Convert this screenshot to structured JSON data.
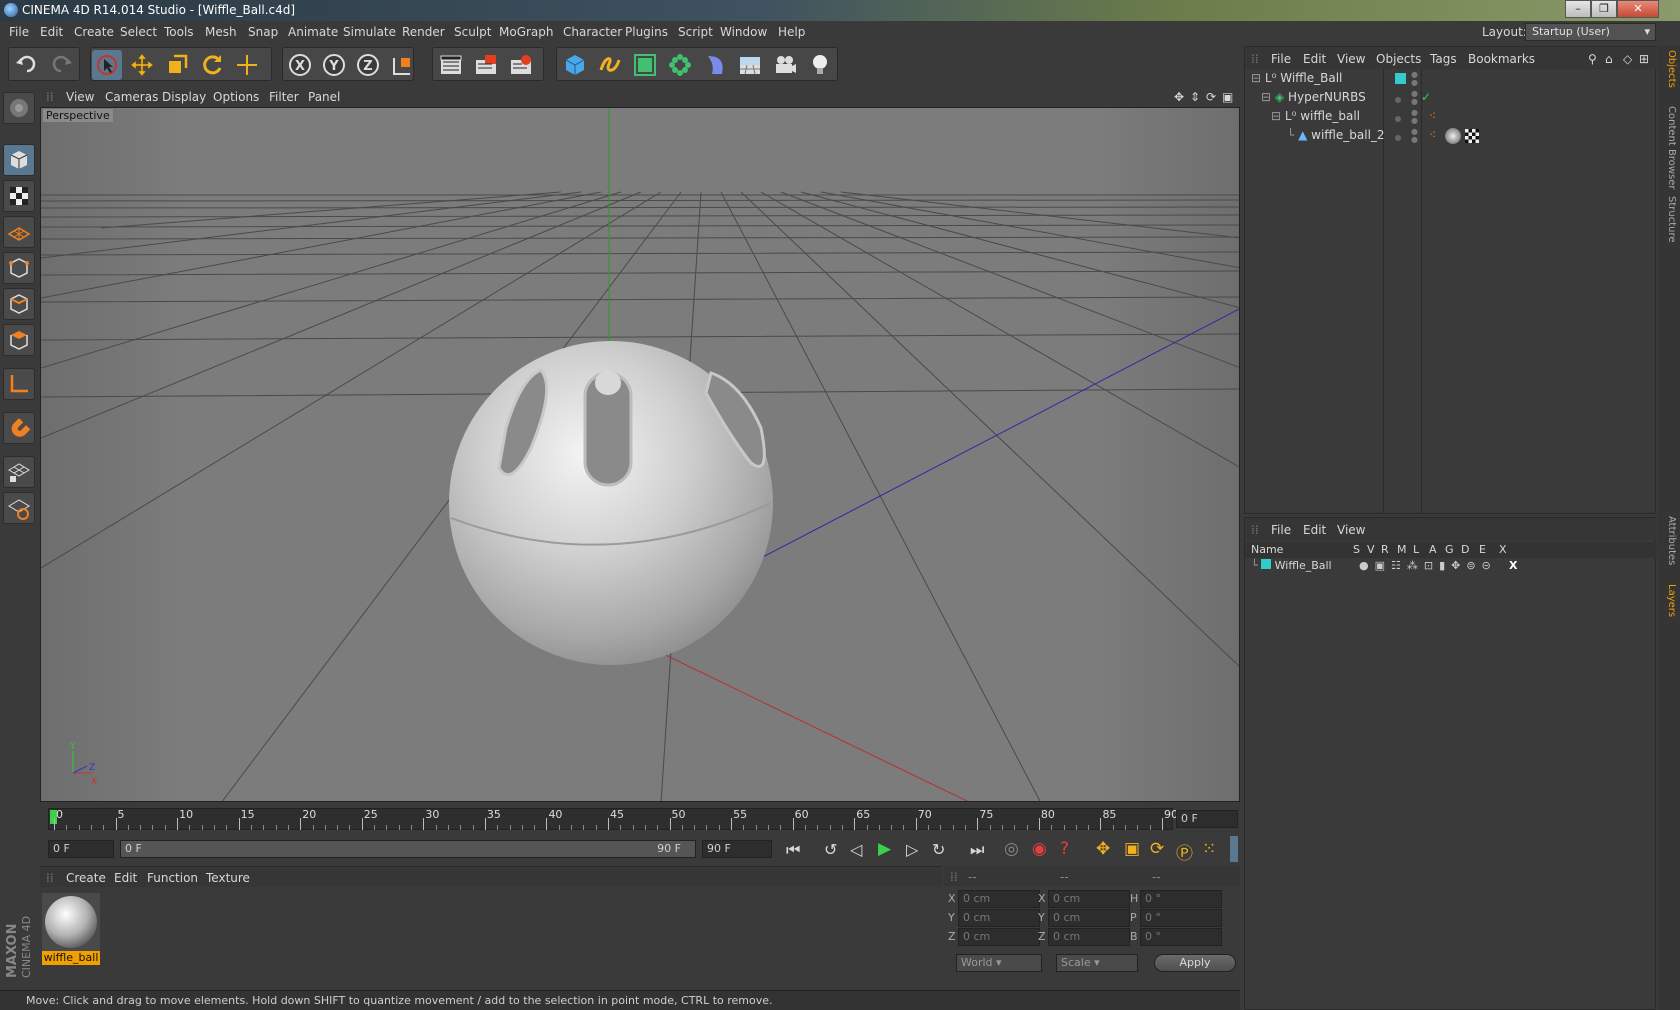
{
  "window": {
    "title": "CINEMA 4D R14.014 Studio - [Wiffle_Ball.c4d]"
  },
  "menu": [
    "File",
    "Edit",
    "Create",
    "Select",
    "Tools",
    "Mesh",
    "Snap",
    "Animate",
    "Simulate",
    "Render",
    "Sculpt",
    "MoGraph",
    "Character",
    "Plugins",
    "Script",
    "Window",
    "Help"
  ],
  "layout": {
    "label": "Layout:",
    "value": "Startup (User)"
  },
  "viewport": {
    "menu": [
      "View",
      "Cameras",
      "Display",
      "Options",
      "Filter",
      "Panel"
    ],
    "label": "Perspective"
  },
  "timeline": {
    "ticks": [
      "0",
      "5",
      "10",
      "15",
      "20",
      "25",
      "30",
      "35",
      "40",
      "45",
      "50",
      "55",
      "60",
      "65",
      "70",
      "75",
      "80",
      "85",
      "90"
    ],
    "current_frame": "0 F",
    "start_frame": "0 F",
    "range_start": "0 F",
    "range_end": "90 F",
    "end_frame": "90 F"
  },
  "material_panel": {
    "menu": [
      "Create",
      "Edit",
      "Function",
      "Texture"
    ],
    "material_name": "wiffle_ball"
  },
  "coords": {
    "headers": [
      "--",
      "--",
      "--"
    ],
    "rows": [
      {
        "a": "X",
        "av": "0 cm",
        "b": "X",
        "bv": "0 cm",
        "c": "H",
        "cv": "0 °"
      },
      {
        "a": "Y",
        "av": "0 cm",
        "b": "Y",
        "bv": "0 cm",
        "c": "P",
        "cv": "0 °"
      },
      {
        "a": "Z",
        "av": "0 cm",
        "b": "Z",
        "bv": "0 cm",
        "c": "B",
        "cv": "0 °"
      }
    ],
    "mode1": "World",
    "mode2": "Scale",
    "apply": "Apply"
  },
  "status": "Move: Click and drag to move elements. Hold down SHIFT to quantize movement / add to the selection in point mode, CTRL to remove.",
  "objects_panel": {
    "menu": [
      "File",
      "Edit",
      "View",
      "Objects",
      "Tags",
      "Bookmarks"
    ],
    "tree": [
      "Wiffle_Ball",
      "HyperNURBS",
      "wiffle_ball",
      "wiffle_ball_2"
    ]
  },
  "layers_panel": {
    "menu": [
      "File",
      "Edit",
      "View"
    ],
    "columns": [
      "Name",
      "S",
      "V",
      "R",
      "M",
      "L",
      "A",
      "G",
      "D",
      "E",
      "X"
    ],
    "rows": [
      "Wiffle_Ball"
    ]
  },
  "side_tabs": [
    "Objects",
    "Content Browser",
    "Structure",
    "Attributes",
    "Layers"
  ],
  "brand": "MAXON CINEMA 4D",
  "colors": {
    "accent": "#5a7890",
    "layer_color": "#33cccc",
    "material_highlight": "#f0a000"
  }
}
